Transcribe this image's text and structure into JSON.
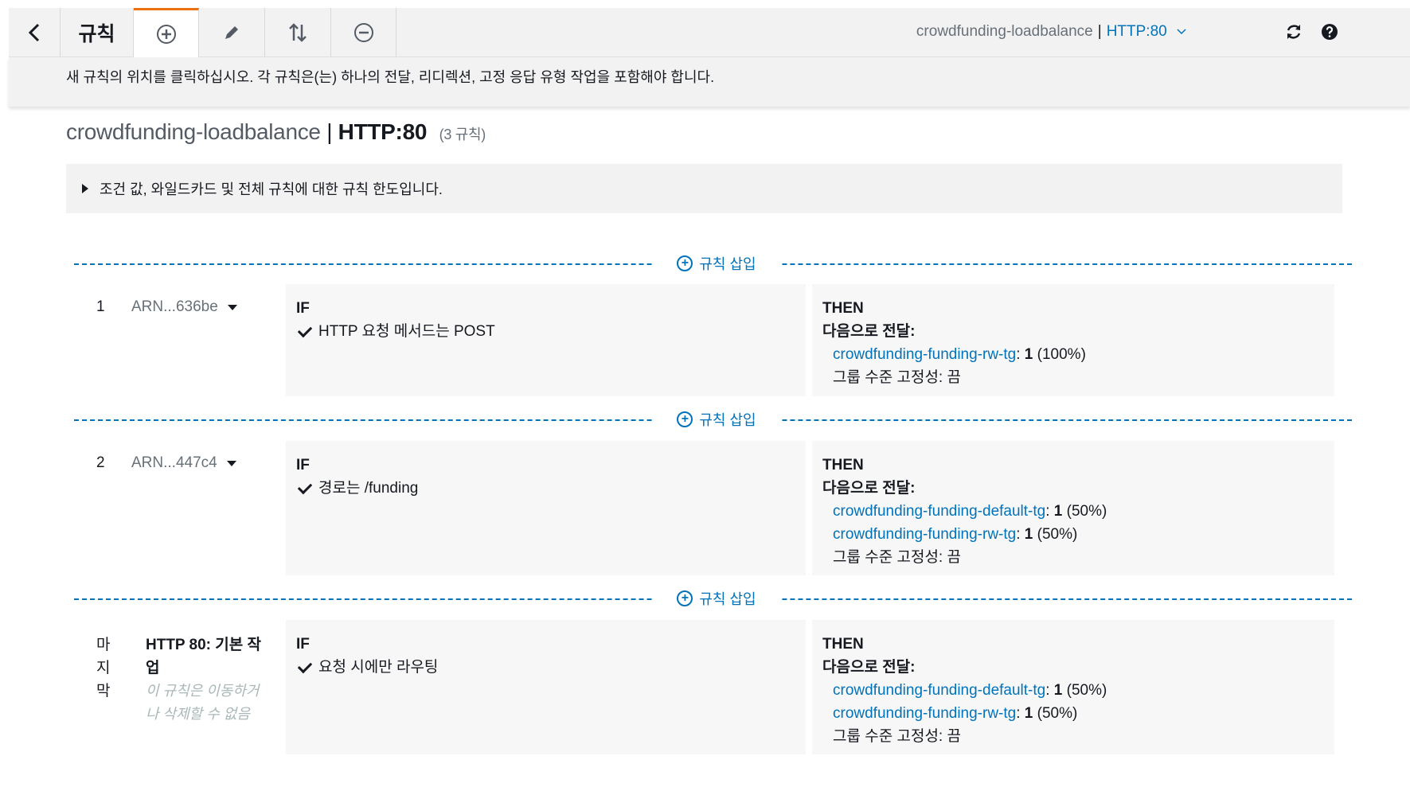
{
  "toolbar": {
    "title": "규칙",
    "lb_name": "crowdfunding-loadbalance",
    "separator": "|",
    "listener": "HTTP:80",
    "icons": [
      "back-arrow-icon",
      "add-icon",
      "edit-icon",
      "reorder-icon",
      "delete-icon",
      "refresh-icon",
      "help-icon"
    ]
  },
  "banner": {
    "text": "새 규칙의 위치를 클릭하십시오. 각 규칙은(는) 하나의 전달, 리디렉션, 고정 응답 유형 작업을 포함해야 합니다."
  },
  "heading": {
    "lb_name": "crowdfunding-loadbalance",
    "separator": "|",
    "listener": "HTTP:80",
    "count": "(3 규칙)"
  },
  "limits": {
    "text": "조건 값, 와일드카드 및 전체 규칙에 대한 규칙 한도입니다."
  },
  "insert_label": "규칙 삽입",
  "labels": {
    "if": "IF",
    "then": "THEN",
    "forward": "다음으로 전달:"
  },
  "rules": [
    {
      "num": "1",
      "arn": "ARN...636be",
      "condition": "HTTP 요청 메서드는 POST",
      "targets": [
        {
          "name": "crowdfunding-funding-rw-tg",
          "sep": ":",
          "weight": "1",
          "pct": "(100%)"
        }
      ],
      "stickiness": "그룹 수준 고정성: 끔"
    },
    {
      "num": "2",
      "arn": "ARN...447c4",
      "condition": "경로는 /funding",
      "targets": [
        {
          "name": "crowdfunding-funding-default-tg",
          "sep": ":",
          "weight": "1",
          "pct": "(50%)"
        },
        {
          "name": "crowdfunding-funding-rw-tg",
          "sep": ":",
          "weight": "1",
          "pct": "(50%)"
        }
      ],
      "stickiness": "그룹 수준 고정성: 끔"
    },
    {
      "num": "마지막",
      "title": "HTTP 80: 기본 작업",
      "note": "이 규칙은 이동하거나 삭제할 수 없음",
      "condition": "요청 시에만 라우팅",
      "targets": [
        {
          "name": "crowdfunding-funding-default-tg",
          "sep": ":",
          "weight": "1",
          "pct": "(50%)"
        },
        {
          "name": "crowdfunding-funding-rw-tg",
          "sep": ":",
          "weight": "1",
          "pct": "(50%)"
        }
      ],
      "stickiness": "그룹 수준 고정성: 끔"
    }
  ]
}
